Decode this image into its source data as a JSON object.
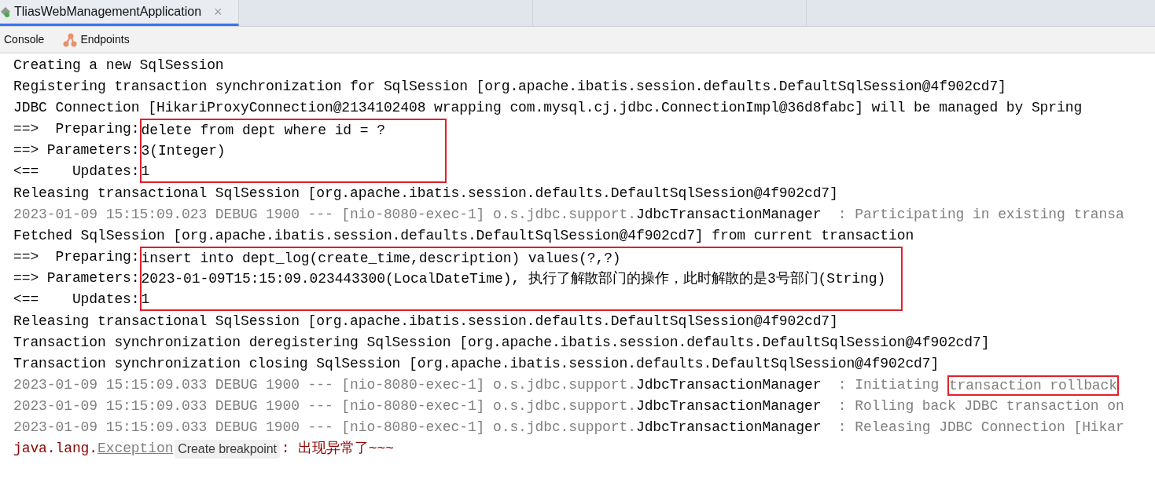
{
  "run_tabs": [
    {
      "title": "TliasWebManagementApplication",
      "close": "×"
    }
  ],
  "toolbar": [
    {
      "label": "Console",
      "kind": "text"
    },
    {
      "label": "Endpoints",
      "kind": "endpoints"
    }
  ],
  "console_lines": [
    {
      "kind": "plain",
      "text": "Creating a new SqlSession"
    },
    {
      "kind": "plain",
      "text": "Registering transaction synchronization for SqlSession [org.apache.ibatis.session.defaults.DefaultSqlSession@4f902cd7]"
    },
    {
      "kind": "plain",
      "text": "JDBC Connection [HikariProxyConnection@2134102408 wrapping com.mysql.cj.jdbc.ConnectionImpl@36d8fabc] will be managed by Spring"
    },
    {
      "kind": "sql",
      "rows": [
        {
          "label": "==>  Preparing:",
          "value": "delete from dept where id = ?"
        },
        {
          "label": "==> Parameters:",
          "value": "3(Integer)"
        },
        {
          "label": "<==    Updates:",
          "value": "1"
        }
      ]
    },
    {
      "kind": "plain",
      "text": "Releasing transactional SqlSession [org.apache.ibatis.session.defaults.DefaultSqlSession@4f902cd7]"
    },
    {
      "kind": "log",
      "prefix": "2023-01-09 15:15:09.023 DEBUG 1900 --- [nio-8080-exec-1] o.s.jdbc.support.",
      "logger": "JdbcTransactionManager",
      "message": "  : Participating in existing transa"
    },
    {
      "kind": "plain",
      "text": "Fetched SqlSession [org.apache.ibatis.session.defaults.DefaultSqlSession@4f902cd7] from current transaction"
    },
    {
      "kind": "sql",
      "rows": [
        {
          "label": "==>  Preparing:",
          "value": "insert into dept_log(create_time,description) values(?,?)"
        },
        {
          "label": "==> Parameters:",
          "value": "2023-01-09T15:15:09.023443300(LocalDateTime), 执行了解散部门的操作，此时解散的是3号部门(String)"
        },
        {
          "label": "<==    Updates:",
          "value": "1"
        }
      ]
    },
    {
      "kind": "plain",
      "text": "Releasing transactional SqlSession [org.apache.ibatis.session.defaults.DefaultSqlSession@4f902cd7]"
    },
    {
      "kind": "plain",
      "text": "Transaction synchronization deregistering SqlSession [org.apache.ibatis.session.defaults.DefaultSqlSession@4f902cd7]"
    },
    {
      "kind": "plain",
      "text": "Transaction synchronization closing SqlSession [org.apache.ibatis.session.defaults.DefaultSqlSession@4f902cd7]"
    },
    {
      "kind": "log",
      "prefix": "2023-01-09 15:15:09.033 DEBUG 1900 --- [nio-8080-exec-1] o.s.jdbc.support.",
      "logger": "JdbcTransactionManager",
      "message": "  : Initiating ",
      "highlight": "transaction rollback"
    },
    {
      "kind": "log",
      "prefix": "2023-01-09 15:15:09.033 DEBUG 1900 --- [nio-8080-exec-1] o.s.jdbc.support.",
      "logger": "JdbcTransactionManager",
      "message": "  : Rolling back JDBC transaction on"
    },
    {
      "kind": "log",
      "prefix": "2023-01-09 15:15:09.033 DEBUG 1900 --- [nio-8080-exec-1] o.s.jdbc.support.",
      "logger": "JdbcTransactionManager",
      "message": "  : Releasing JDBC Connection [Hikar"
    },
    {
      "kind": "exception",
      "prefix": "java.lang.",
      "link": "Exception",
      "hint": "Create breakpoint",
      "message": ": 出现异常了~~~"
    }
  ]
}
